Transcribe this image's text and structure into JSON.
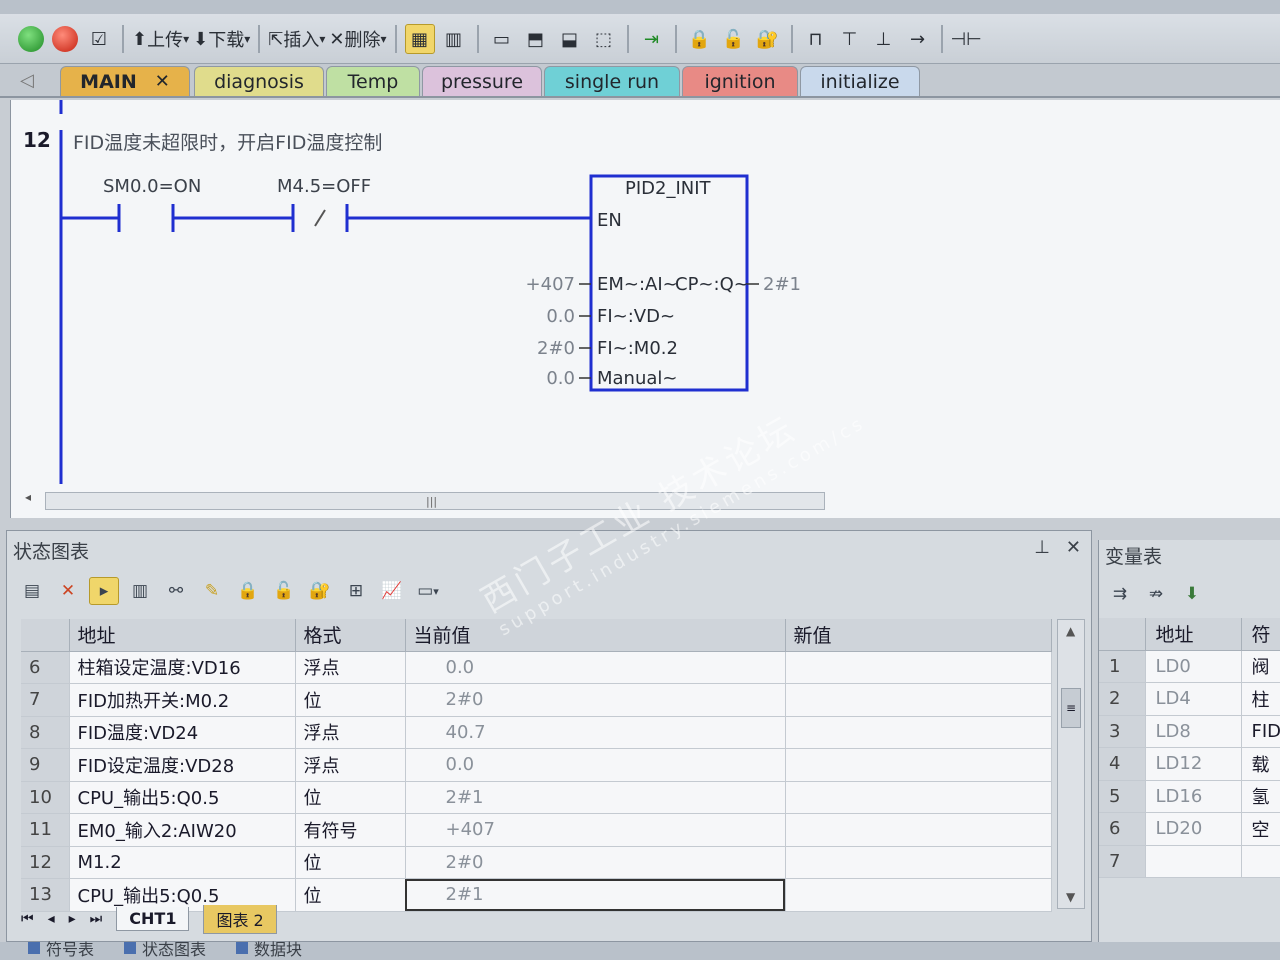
{
  "toolbar": {
    "upload_label": "上传",
    "download_label": "下载",
    "insert_label": "插入",
    "delete_label": "删除"
  },
  "tabs": [
    {
      "label": "MAIN",
      "color": "#e6b24a",
      "closable": true
    },
    {
      "label": "diagnosis",
      "color": "#e0dc8c"
    },
    {
      "label": "Temp",
      "color": "#bfe0a3"
    },
    {
      "label": "pressure",
      "color": "#dcc2dc"
    },
    {
      "label": "single run",
      "color": "#6fd0d6"
    },
    {
      "label": "ignition",
      "color": "#e88a85"
    },
    {
      "label": "initialize",
      "color": "#c9d9ec"
    }
  ],
  "ladder": {
    "network_number": "12",
    "comment": "FID温度未超限时，开启FID温度控制",
    "contact1_label": "SM0.0=ON",
    "contact2_label": "M4.5=OFF",
    "block_name": "PID2_INIT",
    "en": "EN",
    "pins": [
      {
        "name": "EM~:AI~",
        "value": "+407"
      },
      {
        "name": "FI~:VD~",
        "value": "0.0"
      },
      {
        "name": "FI~:M0.2",
        "value": "2#0"
      },
      {
        "name": "Manual~",
        "value": "0.0"
      }
    ],
    "output_pin": "CP~:Q~",
    "output_value": "2#1"
  },
  "status_chart": {
    "title": "状态图表",
    "columns": [
      "地址",
      "格式",
      "当前值",
      "新值"
    ],
    "rows": [
      {
        "idx": "6",
        "address": "柱箱设定温度:VD16",
        "format": "浮点",
        "value": "0.0"
      },
      {
        "idx": "7",
        "address": "FID加热开关:M0.2",
        "format": "位",
        "value": "2#0"
      },
      {
        "idx": "8",
        "address": "FID温度:VD24",
        "format": "浮点",
        "value": "40.7"
      },
      {
        "idx": "9",
        "address": "FID设定温度:VD28",
        "format": "浮点",
        "value": "0.0"
      },
      {
        "idx": "10",
        "address": "CPU_输出5:Q0.5",
        "format": "位",
        "value": "2#1"
      },
      {
        "idx": "11",
        "address": "EM0_输入2:AIW20",
        "format": "有符号",
        "value": "+407"
      },
      {
        "idx": "12",
        "address": "M1.2",
        "format": "位",
        "value": "2#0"
      },
      {
        "idx": "13",
        "address": "CPU_输出5:Q0.5",
        "format": "位",
        "value": "2#1"
      }
    ],
    "sheet_tabs": [
      "CHT1",
      "图表 2"
    ]
  },
  "var_table": {
    "title": "变量表",
    "columns": [
      "地址",
      "符"
    ],
    "rows": [
      {
        "idx": "1",
        "address": "LD0",
        "symbol": "阀"
      },
      {
        "idx": "2",
        "address": "LD4",
        "symbol": "柱"
      },
      {
        "idx": "3",
        "address": "LD8",
        "symbol": "FID"
      },
      {
        "idx": "4",
        "address": "LD12",
        "symbol": "载"
      },
      {
        "idx": "5",
        "address": "LD16",
        "symbol": "氢"
      },
      {
        "idx": "6",
        "address": "LD20",
        "symbol": "空"
      },
      {
        "idx": "7",
        "address": "",
        "symbol": ""
      }
    ]
  },
  "bottom_tabs": [
    "符号表",
    "状态图表",
    "数据块"
  ],
  "watermark": {
    "line1": "西门子工业 技术论坛",
    "line2": "support.industry.siemens.com/cs"
  }
}
